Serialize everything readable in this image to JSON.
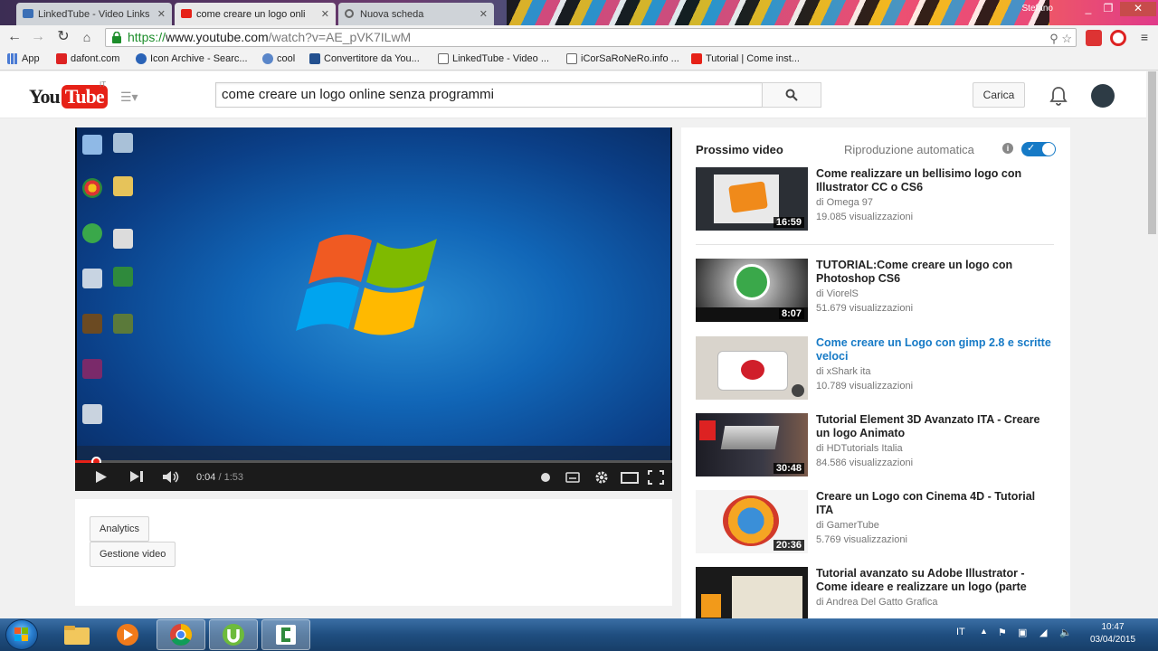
{
  "browser": {
    "tabs": [
      {
        "title": "LinkedTube - Video Links",
        "active": false
      },
      {
        "title": "come creare un logo onli",
        "active": true
      },
      {
        "title": "Nuova scheda",
        "active": false
      }
    ],
    "user": "Stefano",
    "url_scheme": "https://",
    "url_host": "www.youtube.com",
    "url_path": "/watch?v=AE_pVK7ILwM",
    "bookmarks": [
      "App",
      "dafont.com",
      "Icon Archive - Searc...",
      "cool",
      "Convertitore da You...",
      "LinkedTube - Video ...",
      "iCorSaRoNeRo.info ...",
      "Tutorial | Come inst..."
    ]
  },
  "masthead": {
    "logo_you": "You",
    "logo_tube": "Tube",
    "logo_region": "IT",
    "search_query": "come creare un logo online senza programmi",
    "upload_label": "Carica"
  },
  "player": {
    "current_time": "0:04",
    "duration": "/ 1:53",
    "progress": 0.035
  },
  "owner_actions": {
    "analytics": "Analytics",
    "video_manager": "Gestione video"
  },
  "sidebar": {
    "up_next": "Prossimo video",
    "autoplay_label": "Riproduzione automatica",
    "autoplay_on": true,
    "videos": [
      {
        "title": "Come realizzare un bellisimo logo con Illustrator CC o CS6",
        "channel": "di Omega 97",
        "views": "19.085 visualizzazioni",
        "duration": "16:59"
      },
      {
        "title": "TUTORIAL:Come creare un logo con Photoshop CS6",
        "channel": "di ViorelS",
        "views": "51.679 visualizzazioni",
        "duration": "8:07"
      },
      {
        "title": "Come creare un Logo con gimp 2.8 e scritte veloci",
        "channel": "di xShark ita",
        "views": "10.789 visualizzazioni",
        "duration": ""
      },
      {
        "title": "Tutorial Element 3D Avanzato ITA - Creare un logo Animato",
        "channel": "di HDTutorials Italia",
        "views": "84.586 visualizzazioni",
        "duration": "30:48"
      },
      {
        "title": "Creare un Logo con Cinema 4D - Tutorial ITA",
        "channel": "di GamerTube",
        "views": "5.769 visualizzazioni",
        "duration": "20:36"
      },
      {
        "title": "Tutorial avanzato su Adobe Illustrator - Come ideare e realizzare un logo (parte",
        "channel": "di Andrea Del Gatto Grafica",
        "views": "",
        "duration": ""
      }
    ]
  },
  "taskbar": {
    "language": "IT",
    "time": "10:47",
    "date": "03/04/2015"
  },
  "colors": {
    "youtube_red": "#e62117",
    "link_blue": "#167ac6"
  }
}
